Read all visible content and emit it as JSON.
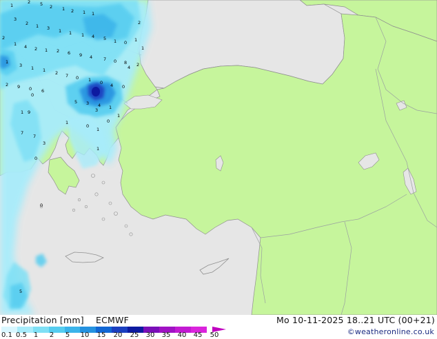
{
  "footer": {
    "title": "Precipitation [mm]",
    "model": "ECMWF",
    "datetime": "Mo 10-11-2025 18..21 UTC (00+21)",
    "credit": "©weatheronline.co.uk"
  },
  "legend": {
    "ticks": [
      "0.1",
      "0.5",
      "1",
      "2",
      "5",
      "10",
      "15",
      "20",
      "25",
      "30",
      "35",
      "40",
      "45",
      "50"
    ],
    "colors": [
      "#d9f7ff",
      "#a8ecfb",
      "#7fe0f5",
      "#56cdf0",
      "#3bb4ea",
      "#2592e0",
      "#1167d4",
      "#1a3fc0",
      "#0d1aa0",
      "#7a0fb8",
      "#a012c4",
      "#c21ad2",
      "#da24dc"
    ],
    "arrow_color": "#c000c0"
  },
  "map_colors": {
    "sea": "#e6e6e6",
    "land": "#c6f59c",
    "border": "#9aa0a0",
    "coast": "#8f8f8f"
  },
  "rain_labels": [
    "2",
    "5",
    "2",
    "1",
    "2",
    "1",
    "1",
    "3",
    "2",
    "1",
    "3",
    "1",
    "1",
    "1",
    "4",
    "5",
    "1",
    "0",
    "2",
    "2",
    "1",
    "4",
    "2",
    "1",
    "2",
    "6",
    "9",
    "4",
    "7",
    "0",
    "8",
    "2",
    "1",
    "3",
    "1",
    "1",
    "2",
    "7",
    "0",
    "1",
    "0",
    "4",
    "0",
    "2",
    "9",
    "0",
    "6",
    "5",
    "3",
    "4",
    "1",
    "9",
    "3",
    "7",
    "7",
    "3",
    "1",
    "0",
    "5",
    "0",
    "1",
    "0",
    "1",
    "1",
    "1",
    "4",
    "1",
    "0",
    "1",
    "0",
    "1"
  ]
}
